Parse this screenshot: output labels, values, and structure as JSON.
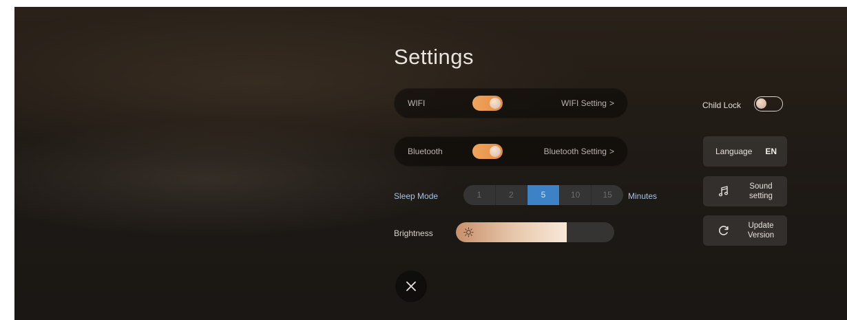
{
  "title": "Settings",
  "wifi": {
    "label": "WIFI",
    "enabled": true,
    "link_label": "WIFI Setting",
    "chevron": ">"
  },
  "bluetooth": {
    "label": "Bluetooth",
    "enabled": true,
    "link_label": "Bluetooth Setting",
    "chevron": ">"
  },
  "sleep_mode": {
    "label": "Sleep Mode",
    "options": [
      "1",
      "2",
      "5",
      "10",
      "15"
    ],
    "selected": "5",
    "unit_label": "Minutes"
  },
  "brightness": {
    "label": "Brightness",
    "level": 0.7,
    "icon": "sun-icon"
  },
  "child_lock": {
    "label": "Child Lock",
    "enabled": false
  },
  "language": {
    "label": "Language",
    "value": "EN"
  },
  "sound": {
    "line1": "Sound",
    "line2": "setting",
    "icon": "music-note-icon"
  },
  "update": {
    "line1": "Update",
    "line2": "Version",
    "icon": "refresh-icon"
  },
  "close": {
    "icon": "close-icon"
  },
  "colors": {
    "accent_orange": "#e9994f",
    "accent_blue": "#3d82c6",
    "text_blue": "#a9c3e6"
  }
}
